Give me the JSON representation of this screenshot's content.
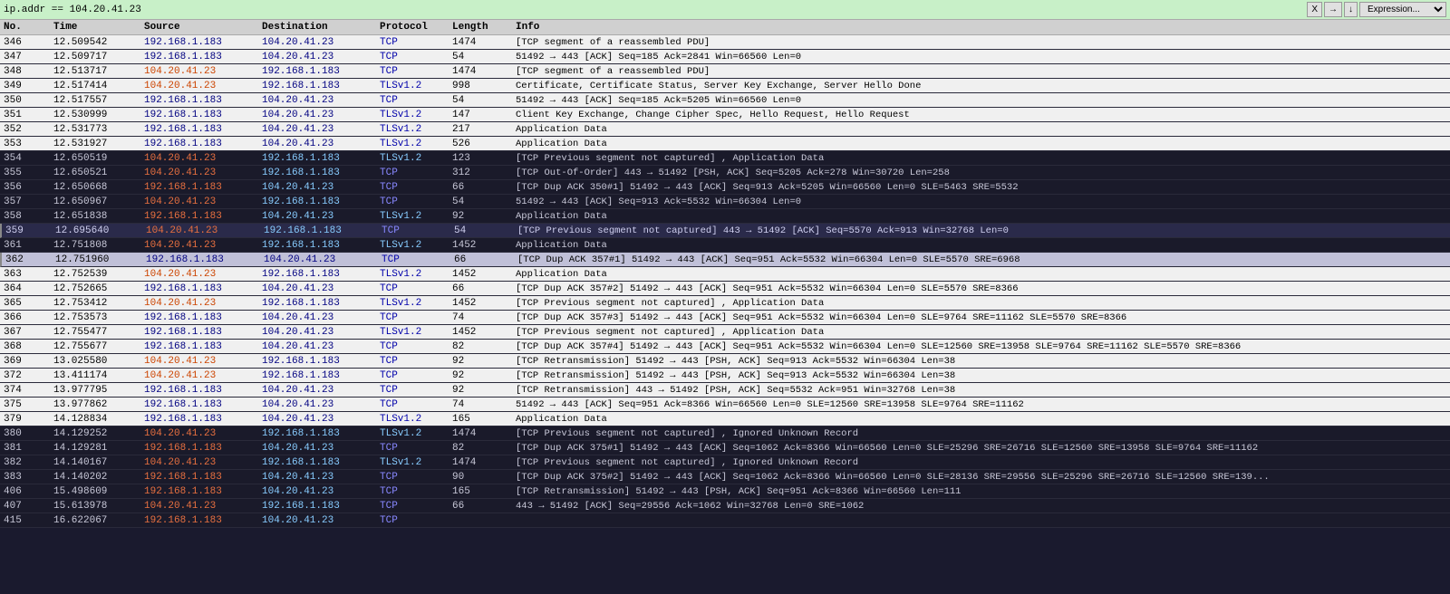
{
  "filter": {
    "text": "ip.addr == 104.20.41.23",
    "buttons": [
      "X",
      "→",
      "↓"
    ],
    "dropdown": "Expression..."
  },
  "columns": [
    "No.",
    "Time",
    "Source",
    "Destination",
    "Protocol",
    "Length",
    "Info"
  ],
  "rows": [
    {
      "no": "346",
      "time": "12.509542",
      "src": "192.168.1.183",
      "dst": "104.20.41.23",
      "proto": "TCP",
      "len": "1474",
      "info": "[TCP segment of a reassembled PDU]",
      "style": "light"
    },
    {
      "no": "347",
      "time": "12.509717",
      "src": "192.168.1.183",
      "dst": "104.20.41.23",
      "proto": "TCP",
      "len": "54",
      "info": "51492 → 443 [ACK] Seq=185 Ack=2841 Win=66560 Len=0",
      "style": "light"
    },
    {
      "no": "348",
      "time": "12.513717",
      "src": "104.20.41.23",
      "dst": "192.168.1.183",
      "proto": "TCP",
      "len": "1474",
      "info": "[TCP segment of a reassembled PDU]",
      "style": "light"
    },
    {
      "no": "349",
      "time": "12.517414",
      "src": "104.20.41.23",
      "dst": "192.168.1.183",
      "proto": "TLSv1.2",
      "len": "998",
      "info": "Certificate, Certificate Status, Server Key Exchange, Server Hello Done",
      "style": "light"
    },
    {
      "no": "350",
      "time": "12.517557",
      "src": "192.168.1.183",
      "dst": "104.20.41.23",
      "proto": "TCP",
      "len": "54",
      "info": "51492 → 443 [ACK] Seq=185 Ack=5205 Win=66560 Len=0",
      "style": "light"
    },
    {
      "no": "351",
      "time": "12.530999",
      "src": "192.168.1.183",
      "dst": "104.20.41.23",
      "proto": "TLSv1.2",
      "len": "147",
      "info": "Client Key Exchange, Change Cipher Spec, Hello Request, Hello Request",
      "style": "light"
    },
    {
      "no": "352",
      "time": "12.531773",
      "src": "192.168.1.183",
      "dst": "104.20.41.23",
      "proto": "TLSv1.2",
      "len": "217",
      "info": "Application Data",
      "style": "light"
    },
    {
      "no": "353",
      "time": "12.531927",
      "src": "192.168.1.183",
      "dst": "104.20.41.23",
      "proto": "TLSv1.2",
      "len": "526",
      "info": "Application Data",
      "style": "light"
    },
    {
      "no": "354",
      "time": "12.650519",
      "src": "104.20.41.23",
      "dst": "192.168.1.183",
      "proto": "TLSv1.2",
      "len": "123",
      "info": "[TCP Previous segment not captured] , Application Data",
      "style": "dark"
    },
    {
      "no": "355",
      "time": "12.650521",
      "src": "104.20.41.23",
      "dst": "192.168.1.183",
      "proto": "TCP",
      "len": "312",
      "info": "[TCP Out-Of-Order] 443 → 51492 [PSH, ACK] Seq=5205 Ack=278 Win=30720 Len=258",
      "style": "dark"
    },
    {
      "no": "356",
      "time": "12.650668",
      "src": "192.168.1.183",
      "dst": "104.20.41.23",
      "proto": "TCP",
      "len": "66",
      "info": "[TCP Dup ACK 350#1] 51492 → 443 [ACK] Seq=913 Ack=5205 Win=66560 Len=0 SLE=5463 SRE=5532",
      "style": "dark"
    },
    {
      "no": "357",
      "time": "12.650967",
      "src": "104.20.41.23",
      "dst": "192.168.1.183",
      "proto": "TCP",
      "len": "54",
      "info": "51492 → 443 [ACK] Seq=913 Ack=5532 Win=66304 Len=0",
      "style": "dark"
    },
    {
      "no": "358",
      "time": "12.651838",
      "src": "192.168.1.183",
      "dst": "104.20.41.23",
      "proto": "TLSv1.2",
      "len": "92",
      "info": "Application Data",
      "style": "dark"
    },
    {
      "no": "359",
      "time": "12.695640",
      "src": "104.20.41.23",
      "dst": "192.168.1.183",
      "proto": "TCP",
      "len": "54",
      "info": "[TCP Previous segment not captured] 443 → 51492 [ACK] Seq=5570 Ack=913 Win=32768 Len=0",
      "style": "selected-dark"
    },
    {
      "no": "361",
      "time": "12.751808",
      "src": "104.20.41.23",
      "dst": "192.168.1.183",
      "proto": "TLSv1.2",
      "len": "1452",
      "info": "Application Data",
      "style": "dark"
    },
    {
      "no": "362",
      "time": "12.751960",
      "src": "192.168.1.183",
      "dst": "104.20.41.23",
      "proto": "TCP",
      "len": "66",
      "info": "[TCP Dup ACK 357#1] 51492 → 443 [ACK] Seq=951 Ack=5532 Win=66304 Len=0 SLE=5570 SRE=6968",
      "style": "selected-light"
    },
    {
      "no": "363",
      "time": "12.752539",
      "src": "104.20.41.23",
      "dst": "192.168.1.183",
      "proto": "TLSv1.2",
      "len": "1452",
      "info": "Application Data",
      "style": "light"
    },
    {
      "no": "364",
      "time": "12.752665",
      "src": "192.168.1.183",
      "dst": "104.20.41.23",
      "proto": "TCP",
      "len": "66",
      "info": "[TCP Dup ACK 357#2] 51492 → 443 [ACK] Seq=951 Ack=5532 Win=66304 Len=0 SLE=5570 SRE=8366",
      "style": "light"
    },
    {
      "no": "365",
      "time": "12.753412",
      "src": "104.20.41.23",
      "dst": "192.168.1.183",
      "proto": "TLSv1.2",
      "len": "1452",
      "info": "[TCP Previous segment not captured] , Application Data",
      "style": "light"
    },
    {
      "no": "366",
      "time": "12.753573",
      "src": "192.168.1.183",
      "dst": "104.20.41.23",
      "proto": "TCP",
      "len": "74",
      "info": "[TCP Dup ACK 357#3] 51492 → 443 [ACK] Seq=951 Ack=5532 Win=66304 Len=0 SLE=9764 SRE=11162 SLE=5570 SRE=8366",
      "style": "light"
    },
    {
      "no": "367",
      "time": "12.755477",
      "src": "192.168.1.183",
      "dst": "104.20.41.23",
      "proto": "TLSv1.2",
      "len": "1452",
      "info": "[TCP Previous segment not captured] , Application Data",
      "style": "light"
    },
    {
      "no": "368",
      "time": "12.755677",
      "src": "192.168.1.183",
      "dst": "104.20.41.23",
      "proto": "TCP",
      "len": "82",
      "info": "[TCP Dup ACK 357#4] 51492 → 443 [ACK] Seq=951 Ack=5532 Win=66304 Len=0 SLE=12560 SRE=13958 SLE=9764 SRE=11162 SLE=5570 SRE=8366",
      "style": "light"
    },
    {
      "no": "369",
      "time": "13.025580",
      "src": "104.20.41.23",
      "dst": "192.168.1.183",
      "proto": "TCP",
      "len": "92",
      "info": "[TCP Retransmission] 51492 → 443 [PSH, ACK] Seq=913 Ack=5532 Win=66304 Len=38",
      "style": "light"
    },
    {
      "no": "372",
      "time": "13.411174",
      "src": "104.20.41.23",
      "dst": "192.168.1.183",
      "proto": "TCP",
      "len": "92",
      "info": "[TCP Retransmission] 51492 → 443 [PSH, ACK] Seq=913 Ack=5532 Win=66304 Len=38",
      "style": "light"
    },
    {
      "no": "374",
      "time": "13.977795",
      "src": "192.168.1.183",
      "dst": "104.20.41.23",
      "proto": "TCP",
      "len": "92",
      "info": "[TCP Retransmission] 443 → 51492 [PSH, ACK] Seq=5532 Ack=951 Win=32768 Len=38",
      "style": "light"
    },
    {
      "no": "375",
      "time": "13.977862",
      "src": "192.168.1.183",
      "dst": "104.20.41.23",
      "proto": "TCP",
      "len": "74",
      "info": "51492 → 443 [ACK] Seq=951 Ack=8366 Win=66560 Len=0 SLE=12560 SRE=13958 SLE=9764 SRE=11162",
      "style": "light"
    },
    {
      "no": "379",
      "time": "14.128834",
      "src": "192.168.1.183",
      "dst": "104.20.41.23",
      "proto": "TLSv1.2",
      "len": "165",
      "info": "Application Data",
      "style": "light"
    },
    {
      "no": "380",
      "time": "14.129252",
      "src": "104.20.41.23",
      "dst": "192.168.1.183",
      "proto": "TLSv1.2",
      "len": "1474",
      "info": "[TCP Previous segment not captured] , Ignored Unknown Record",
      "style": "dark"
    },
    {
      "no": "381",
      "time": "14.129281",
      "src": "192.168.1.183",
      "dst": "104.20.41.23",
      "proto": "TCP",
      "len": "82",
      "info": "[TCP Dup ACK 375#1] 51492 → 443 [ACK] Seq=1062 Ack=8366 Win=66560 Len=0 SLE=25296 SRE=26716 SLE=12560 SRE=13958 SLE=9764 SRE=11162",
      "style": "dark"
    },
    {
      "no": "382",
      "time": "14.140167",
      "src": "104.20.41.23",
      "dst": "192.168.1.183",
      "proto": "TLSv1.2",
      "len": "1474",
      "info": "[TCP Previous segment not captured] , Ignored Unknown Record",
      "style": "dark"
    },
    {
      "no": "383",
      "time": "14.140202",
      "src": "192.168.1.183",
      "dst": "104.20.41.23",
      "proto": "TCP",
      "len": "90",
      "info": "[TCP Dup ACK 375#2] 51492 → 443 [ACK] Seq=1062 Ack=8366 Win=66560 Len=0 SLE=28136 SRE=29556 SLE=25296 SRE=26716 SLE=12560 SRE=139...",
      "style": "dark"
    },
    {
      "no": "406",
      "time": "15.498609",
      "src": "192.168.1.183",
      "dst": "104.20.41.23",
      "proto": "TCP",
      "len": "165",
      "info": "[TCP Retransmission] 51492 → 443 [PSH, ACK] Seq=951 Ack=8366 Win=66560 Len=111",
      "style": "dark"
    },
    {
      "no": "407",
      "time": "15.613978",
      "src": "104.20.41.23",
      "dst": "192.168.1.183",
      "proto": "TCP",
      "len": "66",
      "info": "443 → 51492 [ACK] Seq=29556 Ack=1062 Win=32768 Len=0 SRE=1062",
      "style": "dark"
    },
    {
      "no": "415",
      "time": "16.622067",
      "src": "192.168.1.183",
      "dst": "104.20.41.23",
      "proto": "TCP",
      "len": "",
      "info": "",
      "style": "dark"
    }
  ]
}
